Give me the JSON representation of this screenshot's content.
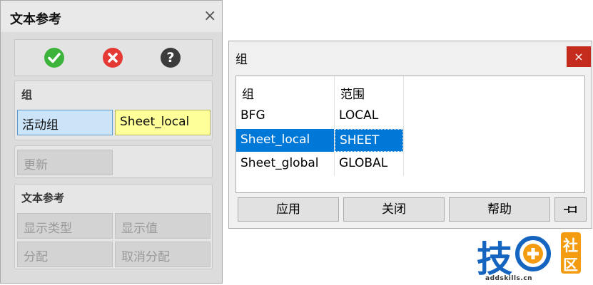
{
  "left_panel": {
    "title": "文本参考",
    "close_glyph": "×",
    "icons": [
      "check-icon",
      "cancel-icon",
      "help-icon"
    ],
    "help_glyph": "?",
    "group_section": {
      "title": "组",
      "active_group_label": "活动组",
      "active_group_value": "Sheet_local"
    },
    "update_button": "更新",
    "text_ref_section": {
      "title": "文本参考",
      "buttons": [
        "显示类型",
        "显示值",
        "分配",
        "取消分配"
      ]
    }
  },
  "group_dialog": {
    "title": "组",
    "close_glyph": "×",
    "columns": [
      "组",
      "范围"
    ],
    "rows": [
      {
        "group": "BFG",
        "scope": "LOCAL"
      },
      {
        "group": "Sheet_local",
        "scope": "SHEET",
        "selected": true
      },
      {
        "group": "Sheet_global",
        "scope": "GLOBAL"
      }
    ],
    "buttons": {
      "apply": "应用",
      "close": "关闭",
      "help": "帮助"
    },
    "pin_icon": "pin-icon"
  },
  "watermark": {
    "logo_text": "技",
    "side_chars": [
      "社",
      "区"
    ],
    "url": "addskills.cn"
  },
  "colors": {
    "selection": "#0078d7",
    "check_green": "#3cb43c",
    "cancel_red": "#e53935",
    "help_dark": "#3c3c3c",
    "field_blue": "#cce4f7",
    "field_yellow": "#ffff99",
    "close_red": "#c42b1c",
    "logo_blue": "#1565c0",
    "logo_orange": "#f39c12"
  }
}
